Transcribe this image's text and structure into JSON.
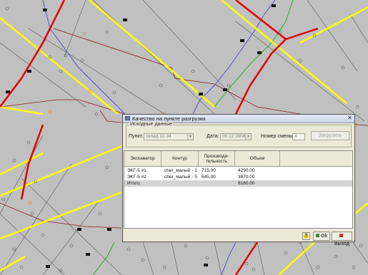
{
  "window": {
    "title": "Качество на пункте разгрузки",
    "close_glyph": "✕"
  },
  "source_group": {
    "title": "Исходные данные",
    "point_label": "Пункт:",
    "point_value": "склад 12-34",
    "date_label": "Дата:",
    "date_value": "05.12.2008",
    "shift_label": "Номер смены:",
    "shift_value": "4",
    "load_button": "Загрузить"
  },
  "table": {
    "columns": [
      "Экскаватор",
      "Контур",
      "Производи-\nтельность",
      "Объем"
    ],
    "rows": [
      [
        "ЭКГ-5 #1",
        "cher_малый - 1",
        "715.00",
        "4290.00"
      ],
      [
        "ЭКГ-5 #2",
        "cher_малый - 5",
        "645.00",
        "3870.00"
      ]
    ],
    "total": {
      "label": "Итого:",
      "value": "8160.00"
    }
  },
  "footer": {
    "ok_label": "Ok",
    "exit_label": "Выход",
    "help_icon": "help-icon"
  },
  "colors": {
    "map_bg": "#c0c0c0",
    "yellow_line": "#ffff00",
    "red_line": "#e00000",
    "dialog_bg": "#ece9d8"
  }
}
